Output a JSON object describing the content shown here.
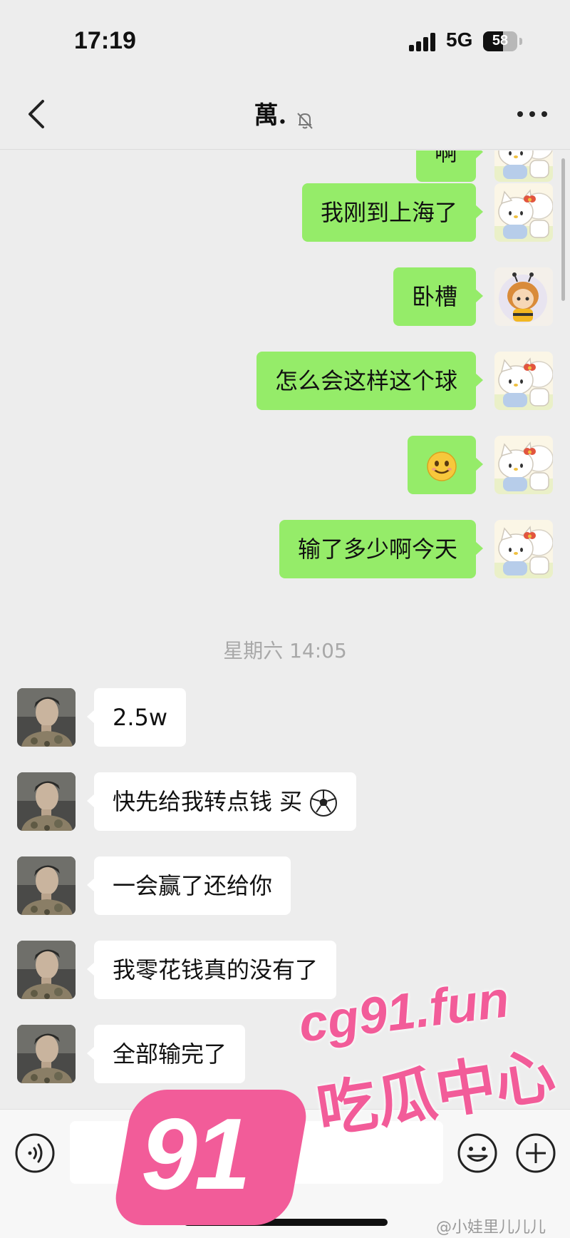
{
  "status_bar": {
    "time": "17:19",
    "network": "5G",
    "battery": "58",
    "battery_level": 0.58
  },
  "header": {
    "title": "萬.",
    "mute_icon": "bell-slash-icon",
    "back_icon": "chevron-left-icon",
    "more_icon": "ellipsis-icon"
  },
  "messages": [
    {
      "side": "me",
      "text": "啊",
      "avatar": "hello-kitty-avatar"
    },
    {
      "side": "me",
      "text": "我刚到上海了",
      "avatar": "hello-kitty-avatar"
    },
    {
      "side": "me",
      "text": "卧槽",
      "avatar": "chibi-bee-avatar"
    },
    {
      "side": "me",
      "text": "怎么会这样这个球",
      "avatar": "hello-kitty-avatar"
    },
    {
      "side": "me",
      "text": "",
      "emoji": "smile-emoji",
      "avatar": "hello-kitty-avatar"
    },
    {
      "side": "me",
      "text": "输了多少啊今天",
      "avatar": "hello-kitty-avatar"
    }
  ],
  "timestamp": "星期六 14:05",
  "replies": [
    {
      "side": "them",
      "text": "2.5w",
      "avatar": "man-portrait-avatar"
    },
    {
      "side": "them",
      "text": "快先给我转点钱 买",
      "emoji": "soccer-ball-emoji",
      "avatar": "man-portrait-avatar"
    },
    {
      "side": "them",
      "text": "一会赢了还给你",
      "avatar": "man-portrait-avatar"
    },
    {
      "side": "them",
      "text": "我零花钱真的没有了",
      "avatar": "man-portrait-avatar"
    },
    {
      "side": "them",
      "text": "全部输完了",
      "avatar": "man-portrait-avatar"
    }
  ],
  "input_bar": {
    "voice_icon": "voice-icon",
    "emoji_icon": "emoji-icon",
    "plus_icon": "plus-icon",
    "text_value": ""
  },
  "watermark": {
    "badge": "91",
    "url": "cg91.fun",
    "cn": "吃瓜中心",
    "weibo": "@小娃里儿儿儿"
  },
  "colors": {
    "background": "#ededed",
    "sent_bubble": "#95ec69",
    "received_bubble": "#ffffff",
    "watermark": "#f25c99"
  }
}
